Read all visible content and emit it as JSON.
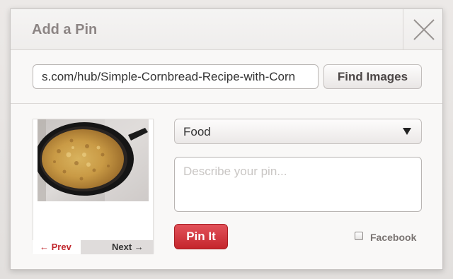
{
  "dialog": {
    "title": "Add a Pin",
    "close_icon": "close-icon"
  },
  "url_bar": {
    "value": "s.com/hub/Simple-Cornbread-Recipe-with-Corn",
    "find_button_label": "Find Images"
  },
  "preview": {
    "image_subject": "cornbread in cast iron skillet",
    "prev_label": "← Prev",
    "next_label": "Next →"
  },
  "board": {
    "selected": "Food",
    "arrow_icon": "triangle-down-icon"
  },
  "description": {
    "placeholder": "Describe your pin...",
    "value": ""
  },
  "actions": {
    "pin_label": "Pin It",
    "facebook_label": "Facebook",
    "facebook_checked": false
  },
  "colors": {
    "accent_red": "#c4252c",
    "title_text": "#8c8584"
  }
}
